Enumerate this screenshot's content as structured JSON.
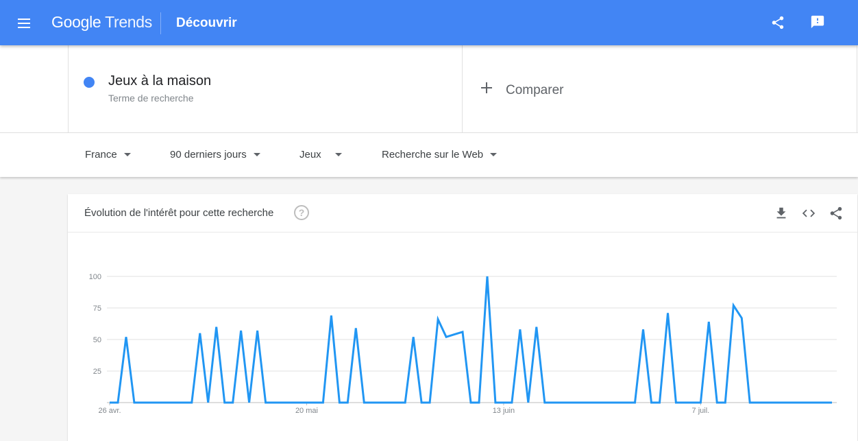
{
  "header": {
    "menu_icon": "hamburger-menu-icon",
    "logo_google": "Google",
    "logo_trends": "Trends",
    "page_title": "Découvrir",
    "share_icon": "share-icon",
    "feedback_icon": "feedback-icon"
  },
  "search": {
    "term": "Jeux à la maison",
    "term_type": "Terme de recherche",
    "term_color": "#4285f4",
    "compare_label": "Comparer"
  },
  "filters": {
    "region": "France",
    "period": "90 derniers jours",
    "category": "Jeux",
    "search_type": "Recherche sur le Web"
  },
  "card": {
    "title": "Évolution de l'intérêt pour cette recherche",
    "help_icon": "help-circle-icon",
    "download_icon": "download-icon",
    "embed_icon": "embed-code-icon",
    "share_icon": "share-icon"
  },
  "chart_data": {
    "type": "line",
    "series_color": "#2196f3",
    "ylim": [
      0,
      100
    ],
    "yticks": [
      25,
      50,
      75,
      100
    ],
    "xtick_labels": [
      "26 avr.",
      "20 mai",
      "13 juin",
      "7 juil."
    ],
    "xtick_indices": [
      0,
      24,
      48,
      72
    ],
    "grid": true,
    "values": [
      0,
      0,
      52,
      0,
      0,
      0,
      0,
      0,
      0,
      0,
      0,
      55,
      0,
      60,
      0,
      0,
      57,
      0,
      57,
      0,
      0,
      0,
      0,
      0,
      0,
      0,
      0,
      69,
      0,
      0,
      59,
      0,
      0,
      0,
      0,
      0,
      0,
      52,
      0,
      0,
      66,
      52,
      54,
      56,
      0,
      0,
      100,
      0,
      0,
      0,
      58,
      0,
      60,
      0,
      0,
      0,
      0,
      0,
      0,
      0,
      0,
      0,
      0,
      0,
      0,
      58,
      0,
      0,
      71,
      0,
      0,
      0,
      0,
      64,
      0,
      0,
      77,
      67,
      0,
      0,
      0,
      0,
      0,
      0,
      0,
      0,
      0,
      0,
      0
    ]
  }
}
